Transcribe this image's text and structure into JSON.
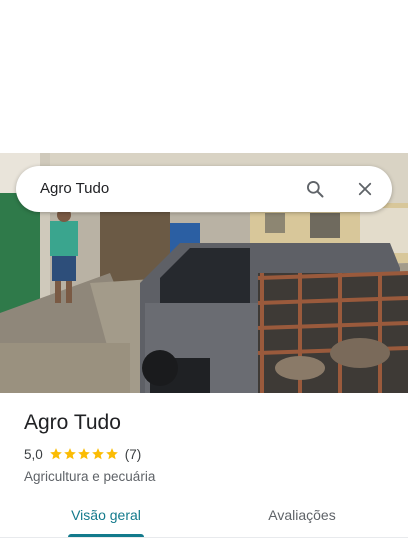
{
  "search": {
    "value": "Agro Tudo",
    "search_icon": "search-icon",
    "close_icon": "close-icon"
  },
  "place": {
    "name": "Agro Tudo",
    "rating": "5,0",
    "stars": 5,
    "review_count": "(7)",
    "category": "Agricultura e pecuária"
  },
  "tabs": [
    {
      "label": "Visão geral",
      "selected": true
    },
    {
      "label": "Avaliações",
      "selected": false
    }
  ],
  "colors": {
    "accent": "#137a8c",
    "star": "#fbbc04",
    "text_primary": "#202124",
    "text_secondary": "#5f6368"
  }
}
